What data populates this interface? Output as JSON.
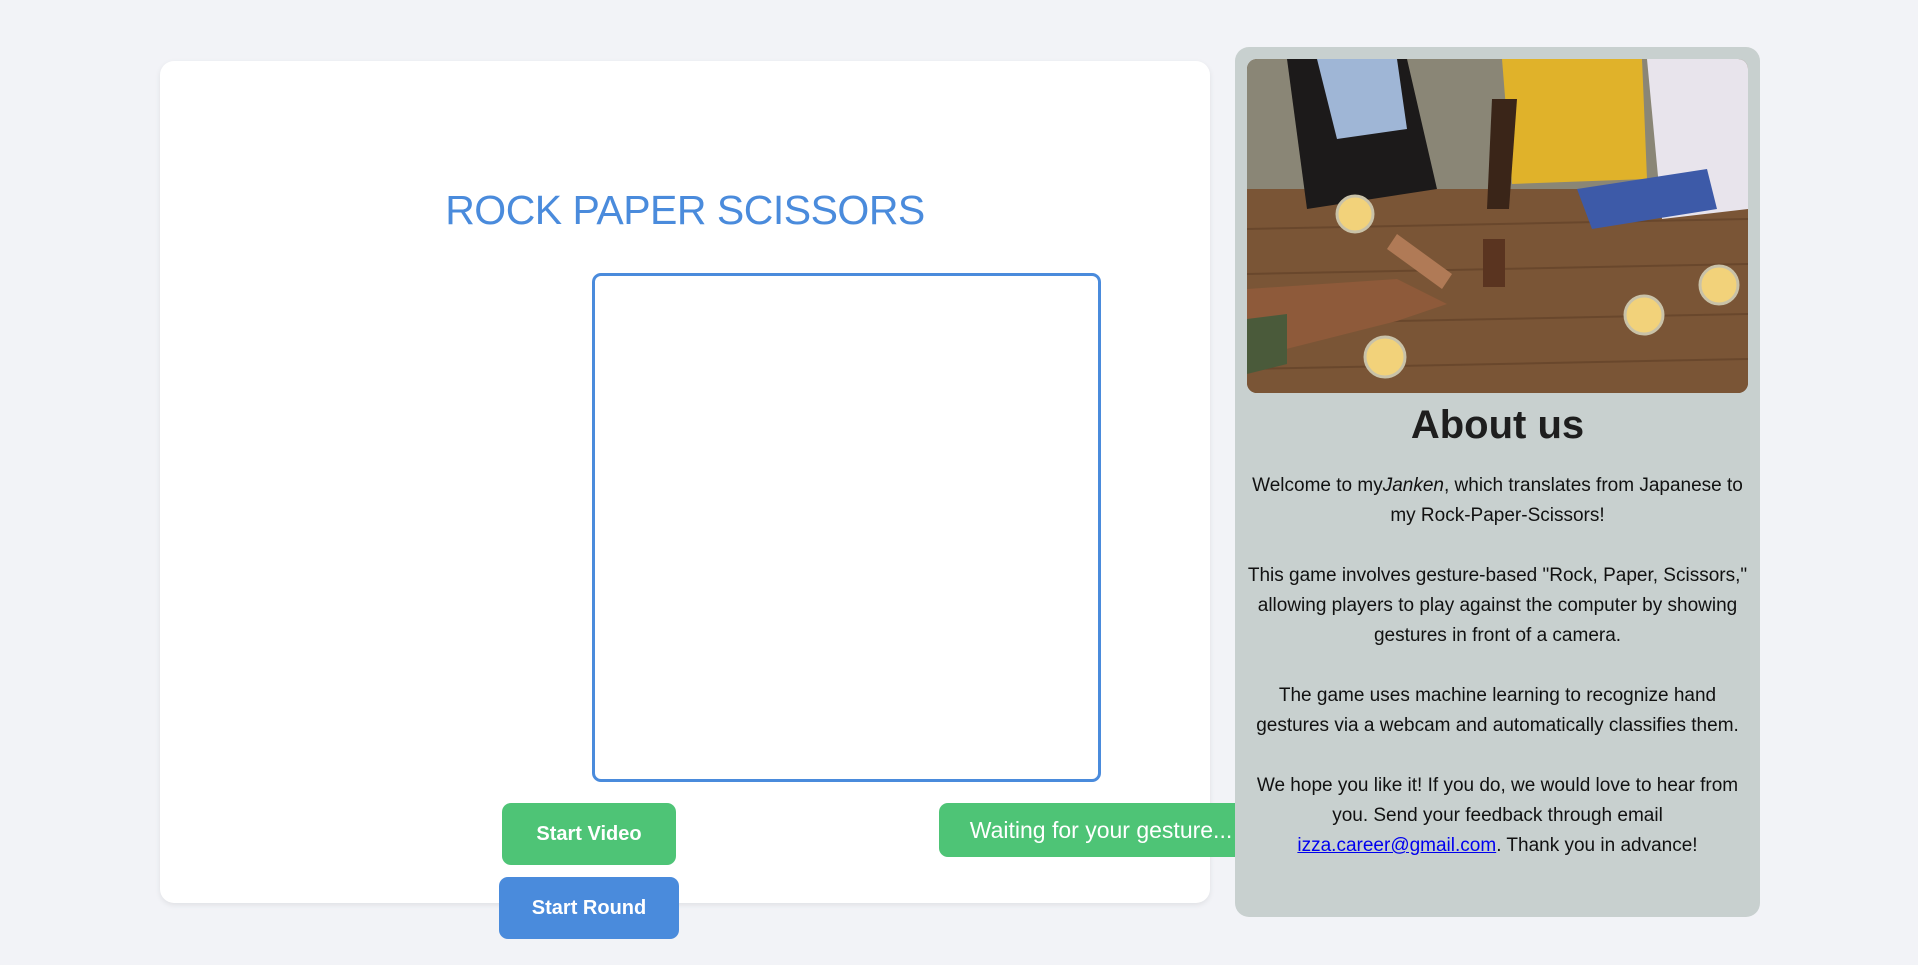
{
  "game": {
    "title": "ROCK PAPER SCISSORS",
    "start_video_label": "Start Video",
    "start_round_label": "Start Round",
    "status_text": "Waiting for your gesture..."
  },
  "about": {
    "title": "About us",
    "p1_before": "Welcome to my",
    "p1_em": "Janken",
    "p1_after": ", which translates from Japanese to my Rock-Paper-Scissors!",
    "p2": "This game involves gesture-based \"Rock, Paper, Scissors,\" allowing players to play against the computer by showing gestures in front of a camera.",
    "p3": "The game uses machine learning to recognize hand gestures via a webcam and automatically classifies them.",
    "p4_before": "We hope you like it! If you do, we would love to hear from you. Send your feedback through email ",
    "email": "izza.career@gmail.com",
    "p4_after": ". Thank you in advance!"
  },
  "colors": {
    "accent_blue": "#4a8bdc",
    "accent_green": "#4ec476",
    "panel_bg": "#c8d0cf",
    "page_bg": "#f2f3f7"
  }
}
